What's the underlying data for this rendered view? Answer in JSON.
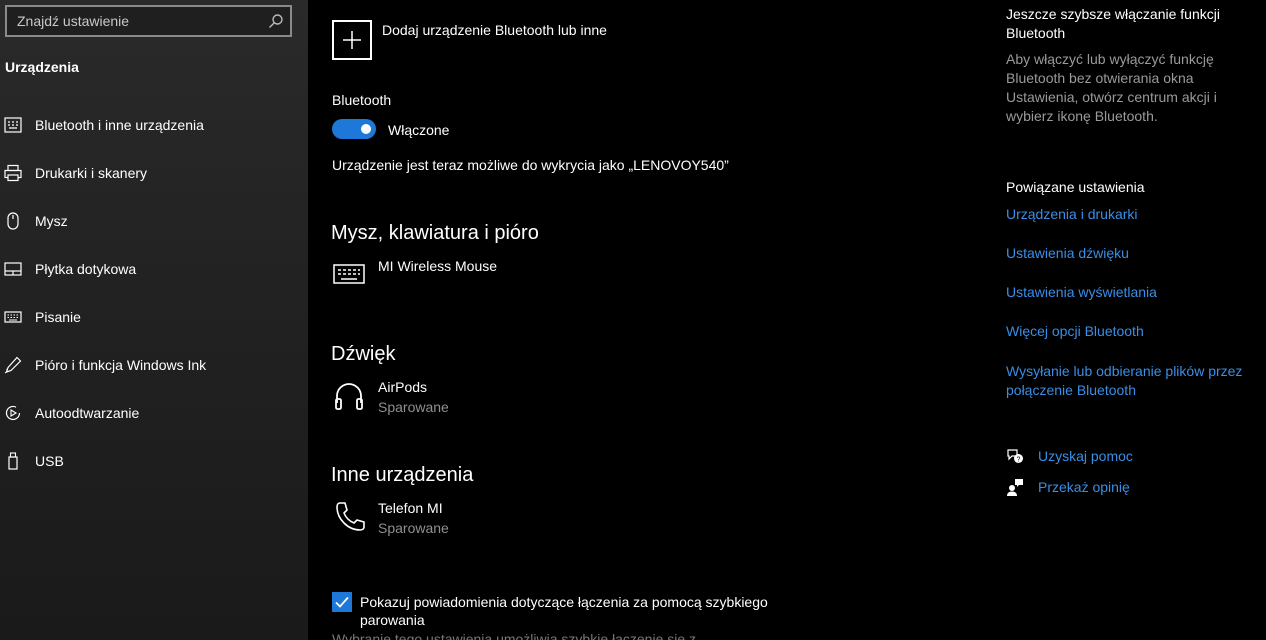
{
  "sidebar": {
    "search_placeholder": "Znajdź ustawienie",
    "section_title": "Urządzenia",
    "items": [
      {
        "label": "Bluetooth i inne urządzenia",
        "icon": "bluetooth-devices-icon"
      },
      {
        "label": "Drukarki i skanery",
        "icon": "printer-icon"
      },
      {
        "label": "Mysz",
        "icon": "mouse-icon"
      },
      {
        "label": "Płytka dotykowa",
        "icon": "touchpad-icon"
      },
      {
        "label": "Pisanie",
        "icon": "keyboard-icon"
      },
      {
        "label": "Pióro i funkcja Windows Ink",
        "icon": "pen-icon"
      },
      {
        "label": "Autoodtwarzanie",
        "icon": "autoplay-icon"
      },
      {
        "label": "USB",
        "icon": "usb-icon"
      }
    ]
  },
  "main": {
    "add_device_label": "Dodaj urządzenie Bluetooth lub inne",
    "bluetooth_label": "Bluetooth",
    "bluetooth_toggle": {
      "state_label": "Włączone",
      "on": true
    },
    "discoverable_text": "Urządzenie jest teraz możliwe do wykrycia jako „LENOVOY540”",
    "groups": [
      {
        "title": "Mysz, klawiatura i pióro",
        "devices": [
          {
            "name": "MI Wireless Mouse",
            "status": "",
            "icon": "keyboard-icon"
          }
        ]
      },
      {
        "title": "Dźwięk",
        "devices": [
          {
            "name": "AirPods",
            "status": "Sparowane",
            "icon": "headphones-icon"
          }
        ]
      },
      {
        "title": "Inne urządzenia",
        "devices": [
          {
            "name": "Telefon MI",
            "status": "Sparowane",
            "icon": "phone-icon"
          }
        ]
      }
    ],
    "swift_pair": {
      "checked": true,
      "label": "Pokazuj powiadomienia dotyczące łączenia za pomocą szybkiego parowania",
      "description": "Wybranie tego ustawienia umożliwia szybkie łączenie się z"
    }
  },
  "right_panel": {
    "tip_title": "Jeszcze szybsze włączanie funkcji Bluetooth",
    "tip_text": "Aby włączyć lub wyłączyć funkcję Bluetooth bez otwierania okna Ustawienia, otwórz centrum akcji i wybierz ikonę Bluetooth.",
    "related_title": "Powiązane ustawienia",
    "links": [
      "Urządzenia i drukarki",
      "Ustawienia dźwięku",
      "Ustawienia wyświetlania",
      "Więcej opcji Bluetooth",
      "Wysyłanie lub odbieranie plików przez połączenie Bluetooth"
    ],
    "help_label": "Uzyskaj pomoc",
    "feedback_label": "Przekaż opinię"
  },
  "colors": {
    "accent": "#1e78d7",
    "link": "#3a8ee6",
    "secondary_text": "#8f8f8f"
  }
}
